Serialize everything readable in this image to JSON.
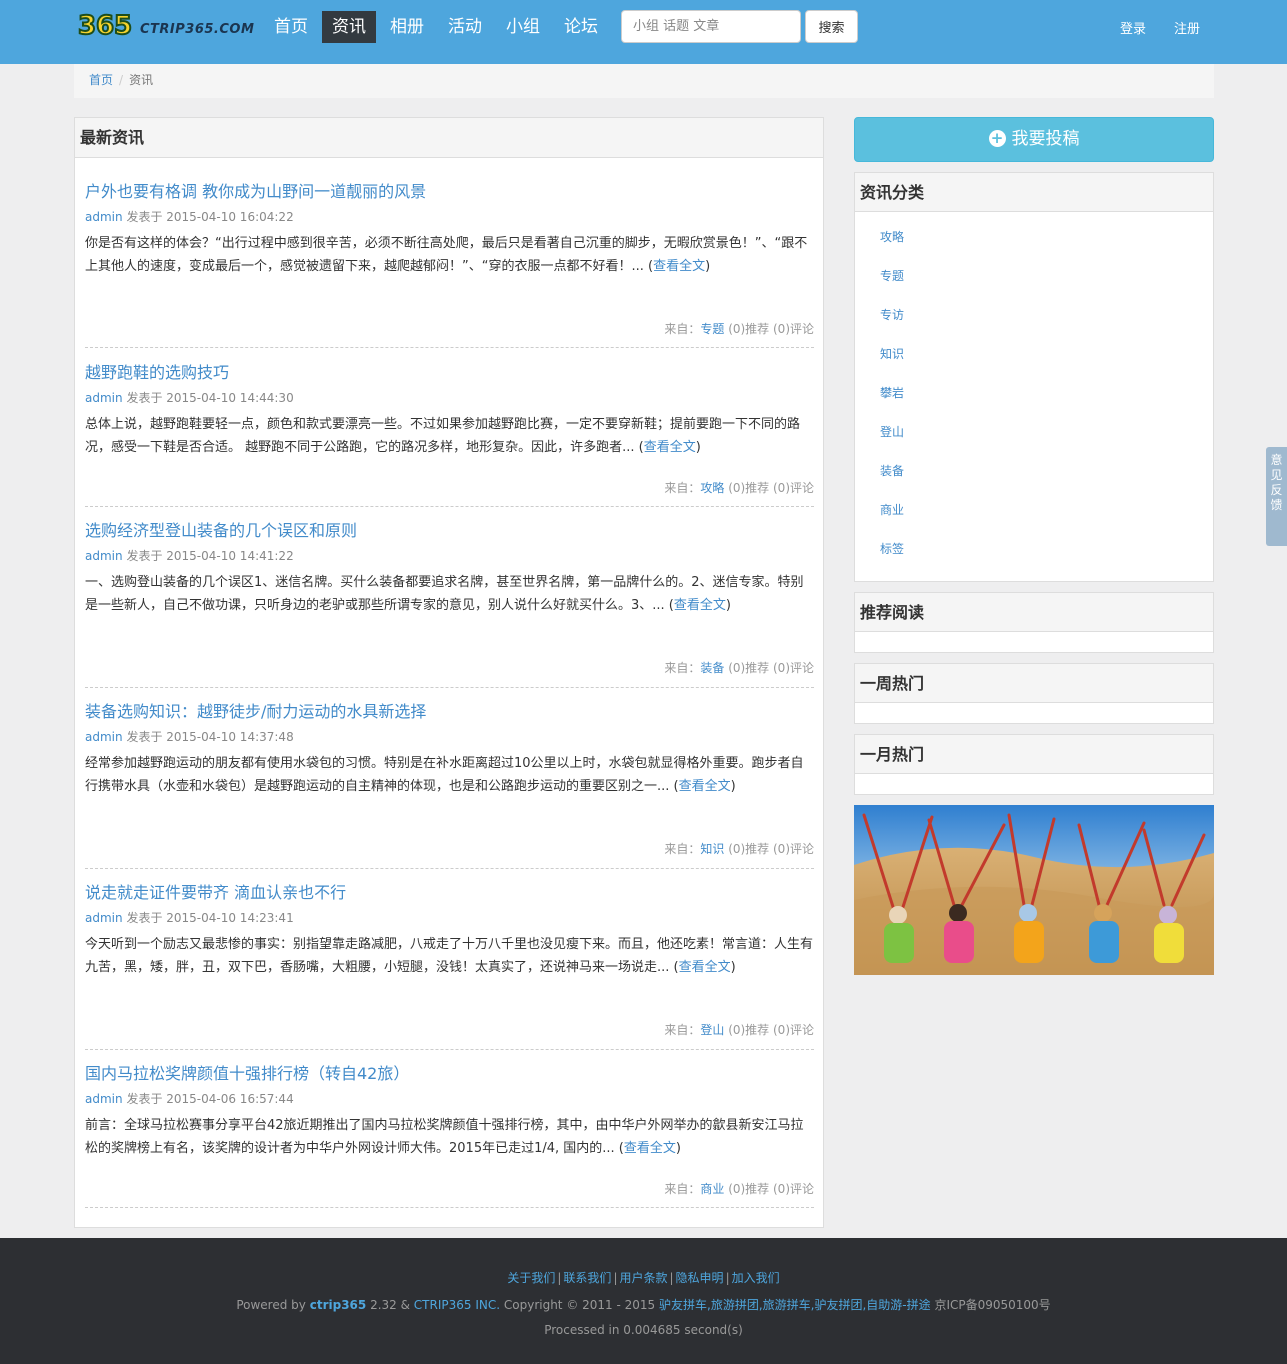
{
  "header": {
    "logo_digits": "365",
    "logo_text": "CTRIP365.COM",
    "nav": [
      "首页",
      "资讯",
      "相册",
      "活动",
      "小组",
      "论坛"
    ],
    "active_nav": "资讯",
    "search_placeholder": "小组 话题 文章",
    "search_button": "搜索",
    "login": "登录",
    "register": "注册"
  },
  "breadcrumb": {
    "home": "首页",
    "separator": "/",
    "current": "资讯"
  },
  "main": {
    "heading": "最新资讯",
    "articles": [
      {
        "title": "户外也要有格调 教你成为山野间一道靓丽的风景",
        "author": "admin",
        "posted": "发表于 2015-04-10 16:04:22",
        "summary": "你是否有这样的体会？“出行过程中感到很辛苦，必须不断往高处爬，最后只是看著自己沉重的脚步，无暇欣赏景色！”、“跟不上其他人的速度，变成最后一个，感觉被遗留下来，越爬越郁闷！”、“穿的衣服一点都不好看！...",
        "read_more": "查看全文",
        "from_label": "来自：",
        "category": "专题",
        "stats": "(0)推荐 (0)评论"
      },
      {
        "title": "越野跑鞋的选购技巧",
        "author": "admin",
        "posted": "发表于 2015-04-10 14:44:30",
        "summary": "  总体上说，越野跑鞋要轻一点，颜色和款式要漂亮一些。不过如果参加越野跑比赛，一定不要穿新鞋；提前要跑一下不同的路况，感受一下鞋是否合适。  越野跑不同于公路跑，它的路况多样，地形复杂。因此，许多跑者...",
        "read_more": "查看全文",
        "from_label": "来自：",
        "category": "攻略",
        "stats": "(0)推荐 (0)评论"
      },
      {
        "title": "选购经济型登山装备的几个误区和原则",
        "author": "admin",
        "posted": "发表于 2015-04-10 14:41:22",
        "summary": "一、选购登山装备的几个误区1、迷信名牌。买什么装备都要追求名牌，甚至世界名牌，第一品牌什么的。2、迷信专家。特别是一些新人，自己不做功课，只听身边的老驴或那些所谓专家的意见，别人说什么好就买什么。3、...",
        "read_more": "查看全文",
        "from_label": "来自：",
        "category": "装备",
        "stats": "(0)推荐 (0)评论"
      },
      {
        "title": "装备选购知识：越野徒步/耐力运动的水具新选择",
        "author": "admin",
        "posted": "发表于 2015-04-10 14:37:48",
        "summary": "经常参加越野跑运动的朋友都有使用水袋包的习惯。特别是在补水距离超过10公里以上时，水袋包就显得格外重要。跑步者自行携带水具（水壶和水袋包）是越野跑运动的自主精神的体现，也是和公路跑步运动的重要区别之一...",
        "read_more": "查看全文",
        "from_label": "来自：",
        "category": "知识",
        "stats": "(0)推荐 (0)评论"
      },
      {
        "title": "说走就走证件要带齐 滴血认亲也不行",
        "author": "admin",
        "posted": "发表于 2015-04-10 14:23:41",
        "summary": "今天听到一个励志又最悲惨的事实：别指望靠走路减肥，八戒走了十万八千里也没见瘦下来。而且，他还吃素！常言道：人生有九苦，黑，矮，胖，丑，双下巴，香肠嘴，大粗腰，小短腿，没钱！太真实了，还说神马来一场说走...",
        "read_more": "查看全文",
        "from_label": "来自：",
        "category": "登山",
        "stats": "(0)推荐 (0)评论"
      },
      {
        "title": "国内马拉松奖牌颜值十强排行榜（转自42旅）",
        "author": "admin",
        "posted": "发表于 2015-04-06 16:57:44",
        "summary": "前言：全球马拉松赛事分享平台42旅近期推出了国内马拉松奖牌颜值十强排行榜，其中，由中华户外网举办的歙县新安江马拉松的奖牌榜上有名，该奖牌的设计者为中华户外网设计师大伟。2015年已走过1/4, 国内的...",
        "read_more": "查看全文",
        "from_label": "来自：",
        "category": "商业",
        "stats": "(0)推荐 (0)评论"
      }
    ]
  },
  "sidebar": {
    "submit_label": "我要投稿",
    "submit_icon": "plus-circle-icon",
    "categories_heading": "资讯分类",
    "categories": [
      "攻略",
      "专题",
      "专访",
      "知识",
      "攀岩",
      "登山",
      "装备",
      "商业",
      "标签"
    ],
    "recommended_heading": "推荐阅读",
    "weekly_heading": "一周热门",
    "monthly_heading": "一月热门"
  },
  "feedback_tab": "意见反馈",
  "footer": {
    "links": [
      "关于我们",
      "联系我们",
      "用户条款",
      "隐私申明",
      "加入我们"
    ],
    "powered_prefix": "Powered by",
    "powered_brand": "ctrip365",
    "powered_version": "2.32 &",
    "company": "CTRIP365 INC.",
    "copyright": "Copyright © 2011 - 2015",
    "site_links": "驴友拼车,旅游拼团,旅游拼车,驴友拼团,自助游-拼途",
    "icp": "京ICP备09050100号",
    "processed": "Processed in 0.004685 second(s)"
  },
  "colors": {
    "header": "#4ea6dd",
    "link": "#428bca",
    "submit": "#5bc0de",
    "footer": "#2d2f33"
  }
}
